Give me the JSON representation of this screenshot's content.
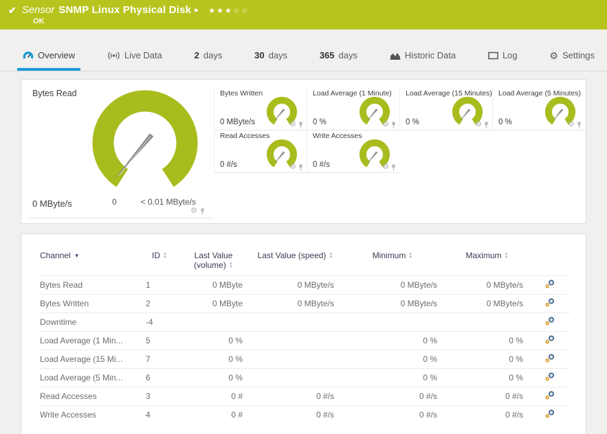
{
  "header": {
    "kind": "Sensor",
    "title": "SNMP Linux Physical Disk",
    "status": "OK",
    "stars": "★★★☆☆"
  },
  "tabs": [
    {
      "label": "Overview",
      "active": true
    },
    {
      "label": "Live Data"
    },
    {
      "num": "2",
      "label": "days"
    },
    {
      "num": "30",
      "label": "days"
    },
    {
      "num": "365",
      "label": "days"
    },
    {
      "label": "Historic Data"
    },
    {
      "label": "Log"
    },
    {
      "label": "Settings"
    }
  ],
  "gauges": {
    "main": {
      "title": "Bytes Read",
      "value": "0 MByte/s",
      "scale_min": "0",
      "scale_max": "< 0.01 MByte/s"
    },
    "small": [
      {
        "title": "Bytes Written",
        "value": "0 MByte/s"
      },
      {
        "title": "Load Average (1 Minute)",
        "value": "0 %"
      },
      {
        "title": "Load Average (15 Minutes)",
        "value": "0 %"
      },
      {
        "title": "Load Average (5 Minutes)",
        "value": "0 %"
      },
      {
        "title": "Read Accesses",
        "value": "0 #/s"
      },
      {
        "title": "Write Accesses",
        "value": "0 #/s"
      }
    ]
  },
  "table": {
    "headers": {
      "channel": "Channel",
      "id": "ID",
      "volume": "Last Value (volume)",
      "speed": "Last Value (speed)",
      "min": "Minimum",
      "max": "Maximum"
    },
    "rows": [
      {
        "channel": "Bytes Read",
        "id": "1",
        "volume": "0 MByte",
        "speed": "0 MByte/s",
        "min": "0 MByte/s",
        "max": "0 MByte/s"
      },
      {
        "channel": "Bytes Written",
        "id": "2",
        "volume": "0 MByte",
        "speed": "0 MByte/s",
        "min": "0 MByte/s",
        "max": "0 MByte/s"
      },
      {
        "channel": "Downtime",
        "id": "-4",
        "volume": "",
        "speed": "",
        "min": "",
        "max": ""
      },
      {
        "channel": "Load Average (1 Min...",
        "id": "5",
        "volume": "0 %",
        "speed": "",
        "min": "0 %",
        "max": "0 %"
      },
      {
        "channel": "Load Average (15 Mi...",
        "id": "7",
        "volume": "0 %",
        "speed": "",
        "min": "0 %",
        "max": "0 %"
      },
      {
        "channel": "Load Average (5 Min...",
        "id": "6",
        "volume": "0 %",
        "speed": "",
        "min": "0 %",
        "max": "0 %"
      },
      {
        "channel": "Read Accesses",
        "id": "3",
        "volume": "0 #",
        "speed": "0 #/s",
        "min": "0 #/s",
        "max": "0 #/s"
      },
      {
        "channel": "Write Accesses",
        "id": "4",
        "volume": "0 #",
        "speed": "0 #/s",
        "min": "0 #/s",
        "max": "0 #/s"
      }
    ]
  },
  "colors": {
    "status_green": "#b7c41d",
    "gauge_green": "#a9bc1e",
    "accent_blue": "#1d9ad7"
  }
}
